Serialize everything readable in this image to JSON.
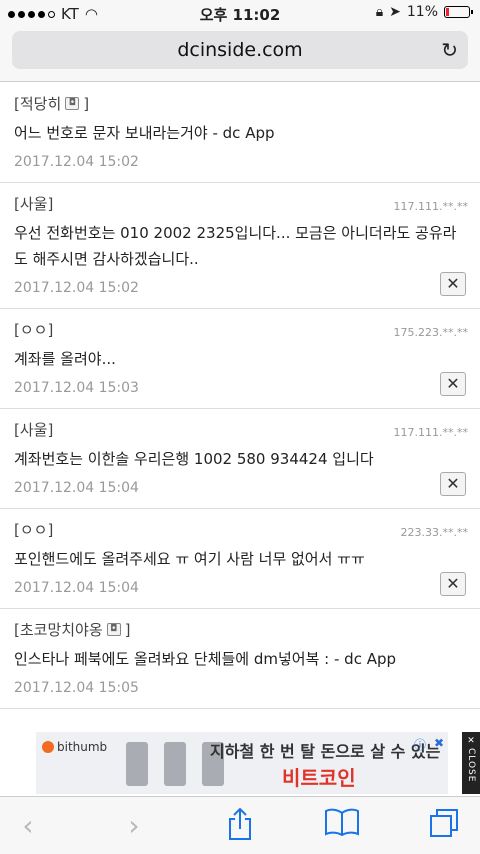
{
  "status": {
    "carrier": "KT",
    "time": "오후 11:02",
    "battery": "11%"
  },
  "browser": {
    "url": "dcinside.com"
  },
  "comments": [
    {
      "author": "[적당히",
      "author_suffix": "]",
      "has_badge": true,
      "ip": "",
      "text": "어느 번호로 문자 보내라는거야 - dc App",
      "date": "2017.12.04 15:02",
      "deletable": false
    },
    {
      "author": "[사울]",
      "ip": "117.111.**.**",
      "text": "우선 전화번호는 010 2002 2325입니다... 모금은 아니더라도 공유라도 해주시면 감사하겠습니다..",
      "date": "2017.12.04 15:02",
      "deletable": true
    },
    {
      "author": "[ㅇㅇ]",
      "ip": "175.223.**.**",
      "text": "계좌를 올려야...",
      "date": "2017.12.04 15:03",
      "deletable": true
    },
    {
      "author": "[사울]",
      "ip": "117.111.**.**",
      "text": "계좌번호는 이한솔 우리은행 1002 580 934424 입니다",
      "date": "2017.12.04 15:04",
      "deletable": true
    },
    {
      "author": "[ㅇㅇ]",
      "ip": "223.33.**.**",
      "text": "포인핸드에도 올려주세요 ㅠ 여기 사람 너무 없어서 ㅠㅠ",
      "date": "2017.12.04 15:04",
      "deletable": true
    },
    {
      "author": "[초코망치야옹",
      "author_suffix": "]",
      "has_badge": true,
      "ip": "",
      "text": "인스타나 페북에도 올려봐요 단체들에 dm넣어복 : - dc App",
      "date": "2017.12.04 15:05",
      "deletable": false
    }
  ],
  "ad": {
    "brand": "bithumb",
    "line1": "지하철 한 번 탈 돈으로 살 수 있는",
    "line2": "비트코인",
    "close_label": "CLOSE"
  },
  "toolbar": {
    "back": "‹",
    "forward": "›",
    "share": "⇧",
    "bookmarks": "📖",
    "tabs": "⧉"
  }
}
